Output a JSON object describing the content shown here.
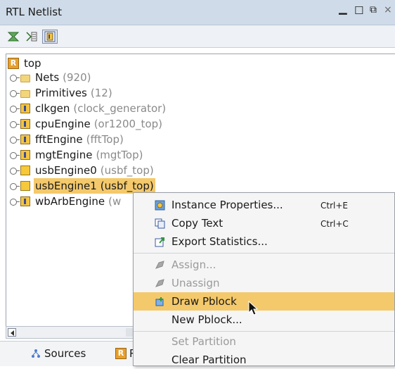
{
  "window": {
    "title": "RTL Netlist",
    "controls": {
      "minimize": "▁",
      "maximize": "☐",
      "restore": "⧉",
      "close": "×"
    }
  },
  "toolbar": {
    "buttons": [
      {
        "name": "collapse-all-icon"
      },
      {
        "name": "expand-all-icon"
      },
      {
        "name": "show-hierarchy-icon",
        "pressed": true
      }
    ]
  },
  "tree": {
    "root": {
      "label": "top"
    },
    "items": [
      {
        "label": "Nets",
        "detail": "(920)",
        "icon": "folder"
      },
      {
        "label": "Primitives",
        "detail": "(12)",
        "icon": "folder"
      },
      {
        "label": "clkgen",
        "detail": "(clock_generator)",
        "icon": "instance"
      },
      {
        "label": "cpuEngine",
        "detail": "(or1200_top)",
        "icon": "instance"
      },
      {
        "label": "fftEngine",
        "detail": "(fftTop)",
        "icon": "instance"
      },
      {
        "label": "mgtEngine",
        "detail": "(mgtTop)",
        "icon": "instance"
      },
      {
        "label": "usbEngine0",
        "detail": "(usbf_top)",
        "icon": "instance-plain"
      },
      {
        "label": "usbEngine1",
        "detail": "(usbf_top)",
        "icon": "instance-plain",
        "selected": true
      },
      {
        "label": "wbArbEngine",
        "detail": "(w",
        "icon": "instance"
      }
    ]
  },
  "tabs": {
    "sources": "Sources",
    "second": "R"
  },
  "context_menu": {
    "items": [
      {
        "label": "Instance Properties...",
        "shortcut": "Ctrl+E",
        "icon": "properties-icon"
      },
      {
        "label": "Copy Text",
        "shortcut": "Ctrl+C",
        "icon": "copy-icon"
      },
      {
        "label": "Export Statistics...",
        "shortcut": "",
        "icon": "export-icon"
      },
      {
        "label": "Assign...",
        "shortcut": "",
        "icon": "assign-icon",
        "disabled": true
      },
      {
        "label": "Unassign",
        "shortcut": "",
        "icon": "unassign-icon",
        "disabled": true
      },
      {
        "label": "Draw Pblock",
        "shortcut": "",
        "icon": "draw-pblock-icon",
        "highlight": true
      },
      {
        "label": "New Pblock...",
        "shortcut": ""
      },
      {
        "label": "Set Partition",
        "shortcut": "",
        "disabled": true
      },
      {
        "label": "Clear Partition",
        "shortcut": ""
      }
    ]
  },
  "colors": {
    "titlebar": "#cfdbe8",
    "selection": "#f4c96b",
    "disabled_text": "#9a9a9a"
  }
}
